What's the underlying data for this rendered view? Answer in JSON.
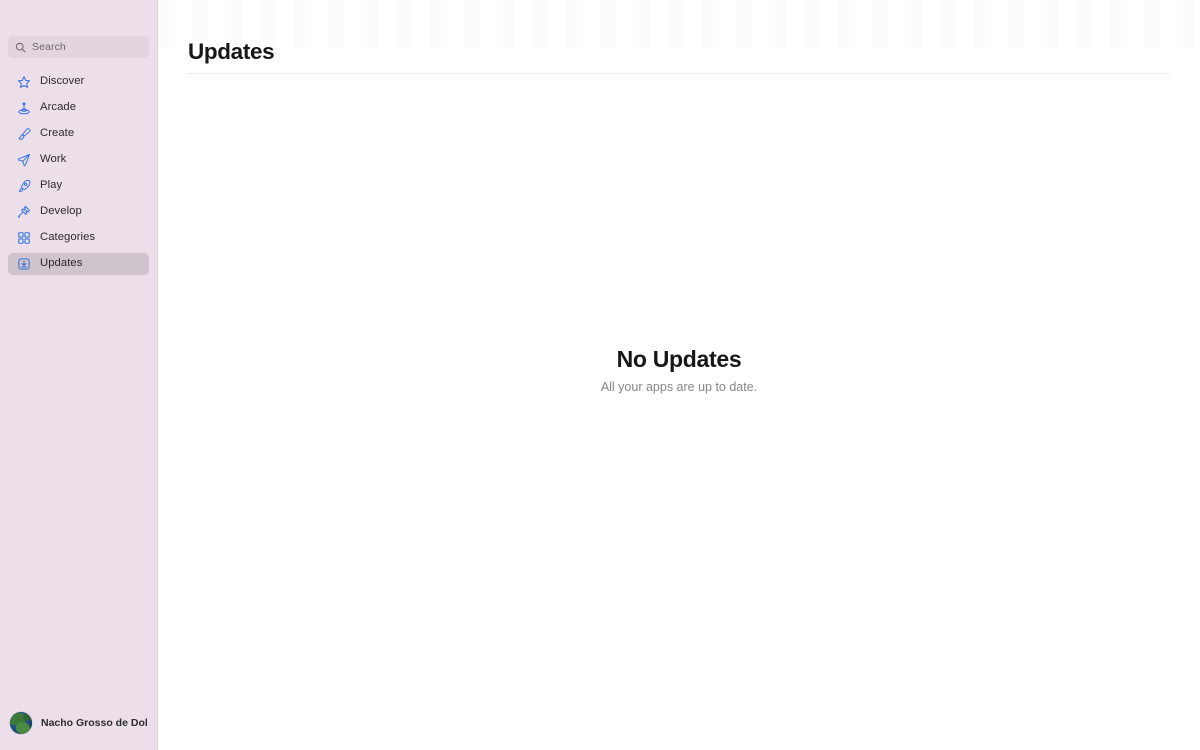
{
  "theme": {
    "sidebar_bg": "#ecdfe9",
    "sidebar_border": "#dfd2dc",
    "sidebar_selected_bg": "#cfc3cd",
    "search_bg": "#e3d5e0",
    "accent_icon": "#3a74de",
    "content_bg": "#ffffff",
    "title_color": "#17171a",
    "muted_text": "#86868b",
    "divider": "#ececec"
  },
  "sidebar": {
    "search": {
      "placeholder": "Search",
      "value": "",
      "icon": "search-icon"
    },
    "items": [
      {
        "id": "discover",
        "label": "Discover",
        "icon": "star-icon",
        "selected": false
      },
      {
        "id": "arcade",
        "label": "Arcade",
        "icon": "joystick-icon",
        "selected": false
      },
      {
        "id": "create",
        "label": "Create",
        "icon": "paintbrush-icon",
        "selected": false
      },
      {
        "id": "work",
        "label": "Work",
        "icon": "paper-plane-icon",
        "selected": false
      },
      {
        "id": "play",
        "label": "Play",
        "icon": "rocket-icon",
        "selected": false
      },
      {
        "id": "develop",
        "label": "Develop",
        "icon": "hammer-icon",
        "selected": false
      },
      {
        "id": "categories",
        "label": "Categories",
        "icon": "grid-icon",
        "selected": false
      },
      {
        "id": "updates",
        "label": "Updates",
        "icon": "download-icon",
        "selected": true
      }
    ],
    "profile": {
      "name": "Nacho Grosso de Dola...",
      "avatar": "globe-avatar"
    }
  },
  "main": {
    "header": {
      "title": "Updates"
    },
    "empty_state": {
      "title": "No Updates",
      "subtitle": "All your apps are up to date."
    }
  }
}
